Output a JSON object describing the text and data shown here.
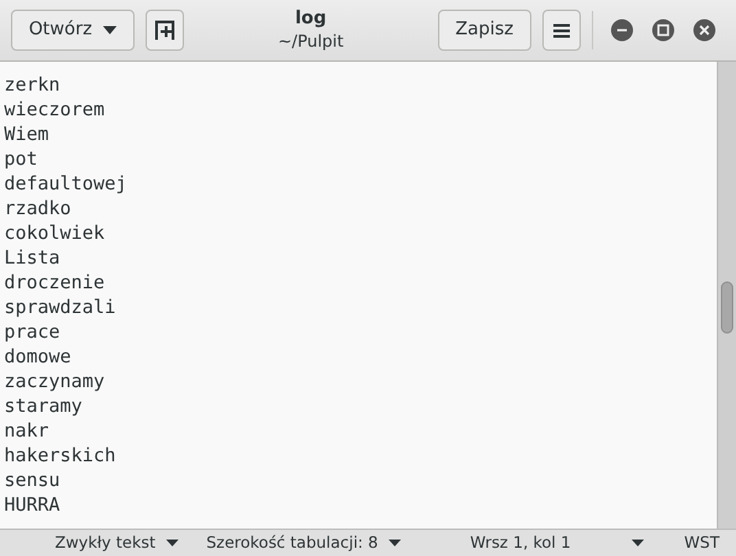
{
  "header": {
    "open_button": "Otwórz",
    "title": "log",
    "subtitle": "~/Pulpit",
    "save_button": "Zapisz"
  },
  "lines": [
    "zerkn",
    "wieczorem",
    "Wiem",
    "pot",
    "defaultowej",
    "rzadko",
    "cokolwiek",
    "Lista",
    "droczenie",
    "sprawdzali",
    "prace",
    "domowe",
    "zaczynamy",
    "staramy",
    "nakr",
    "hakerskich",
    "sensu",
    "HURRA"
  ],
  "status_bar": {
    "language": "Zwykły tekst",
    "tab_width": "Szerokość tabulacji: 8",
    "position": "Wrsz 1, kol 1",
    "mode": "WST"
  }
}
